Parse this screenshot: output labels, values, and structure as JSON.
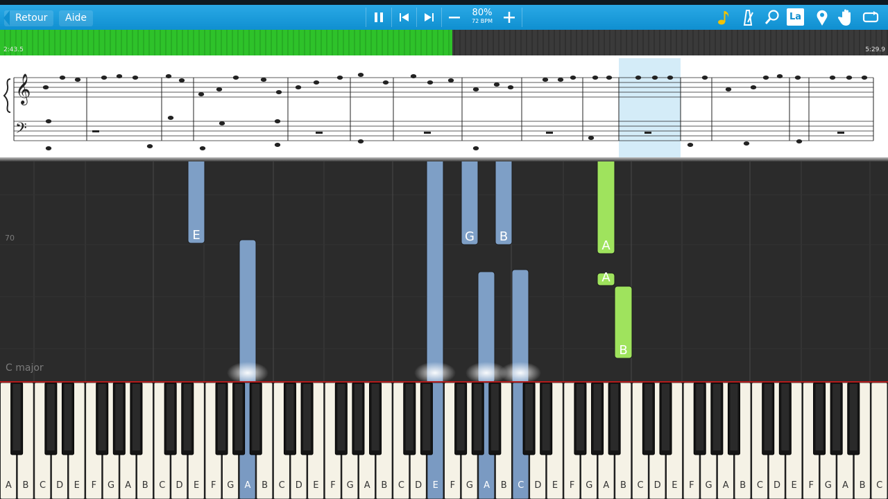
{
  "toolbar": {
    "back_label": "Retour",
    "help_label": "Aide",
    "pause_icon": "pause-icon",
    "prev_icon": "skip-back-icon",
    "next_icon": "skip-forward-icon",
    "minus_icon": "minus-icon",
    "plus_icon": "plus-icon",
    "speed_percent": "80%",
    "speed_bpm": "72 BPM",
    "right_icons": [
      "note-icon",
      "metronome-icon",
      "search-icon",
      "la-label-icon",
      "location-pin-icon",
      "hand-icon",
      "loop-icon"
    ],
    "label_button_text": "La"
  },
  "progress": {
    "elapsed": "2:43.5",
    "total": "5:29.9",
    "played_fraction": 0.509
  },
  "roll": {
    "octave_marker": "70",
    "key_signature": "C major",
    "falling_notes": [
      "E",
      "G",
      "B",
      "A",
      "A",
      "B"
    ]
  },
  "keyboard": {
    "white_keys": [
      "A",
      "B",
      "C",
      "D",
      "E",
      "F",
      "G",
      "A",
      "B",
      "C",
      "D",
      "E",
      "F",
      "G",
      "A",
      "B",
      "C",
      "D",
      "E",
      "F",
      "G",
      "A",
      "B",
      "C",
      "D",
      "E",
      "F",
      "G",
      "A",
      "B",
      "C",
      "D",
      "E",
      "F",
      "G",
      "A",
      "B",
      "C",
      "D",
      "E",
      "F",
      "G",
      "A",
      "B",
      "C",
      "D",
      "E",
      "F",
      "G",
      "A",
      "B",
      "C"
    ],
    "pressed_keys": [
      "A",
      "E",
      "A",
      "C"
    ]
  },
  "colors": {
    "toolbar": "#1a9ddd",
    "progress_played": "#2ec22a",
    "note_blue": "#7e9fc6",
    "note_green": "#9fe35d",
    "key_pressed": "#7a9ac2",
    "highlight_measure": "#d4ecf8"
  }
}
